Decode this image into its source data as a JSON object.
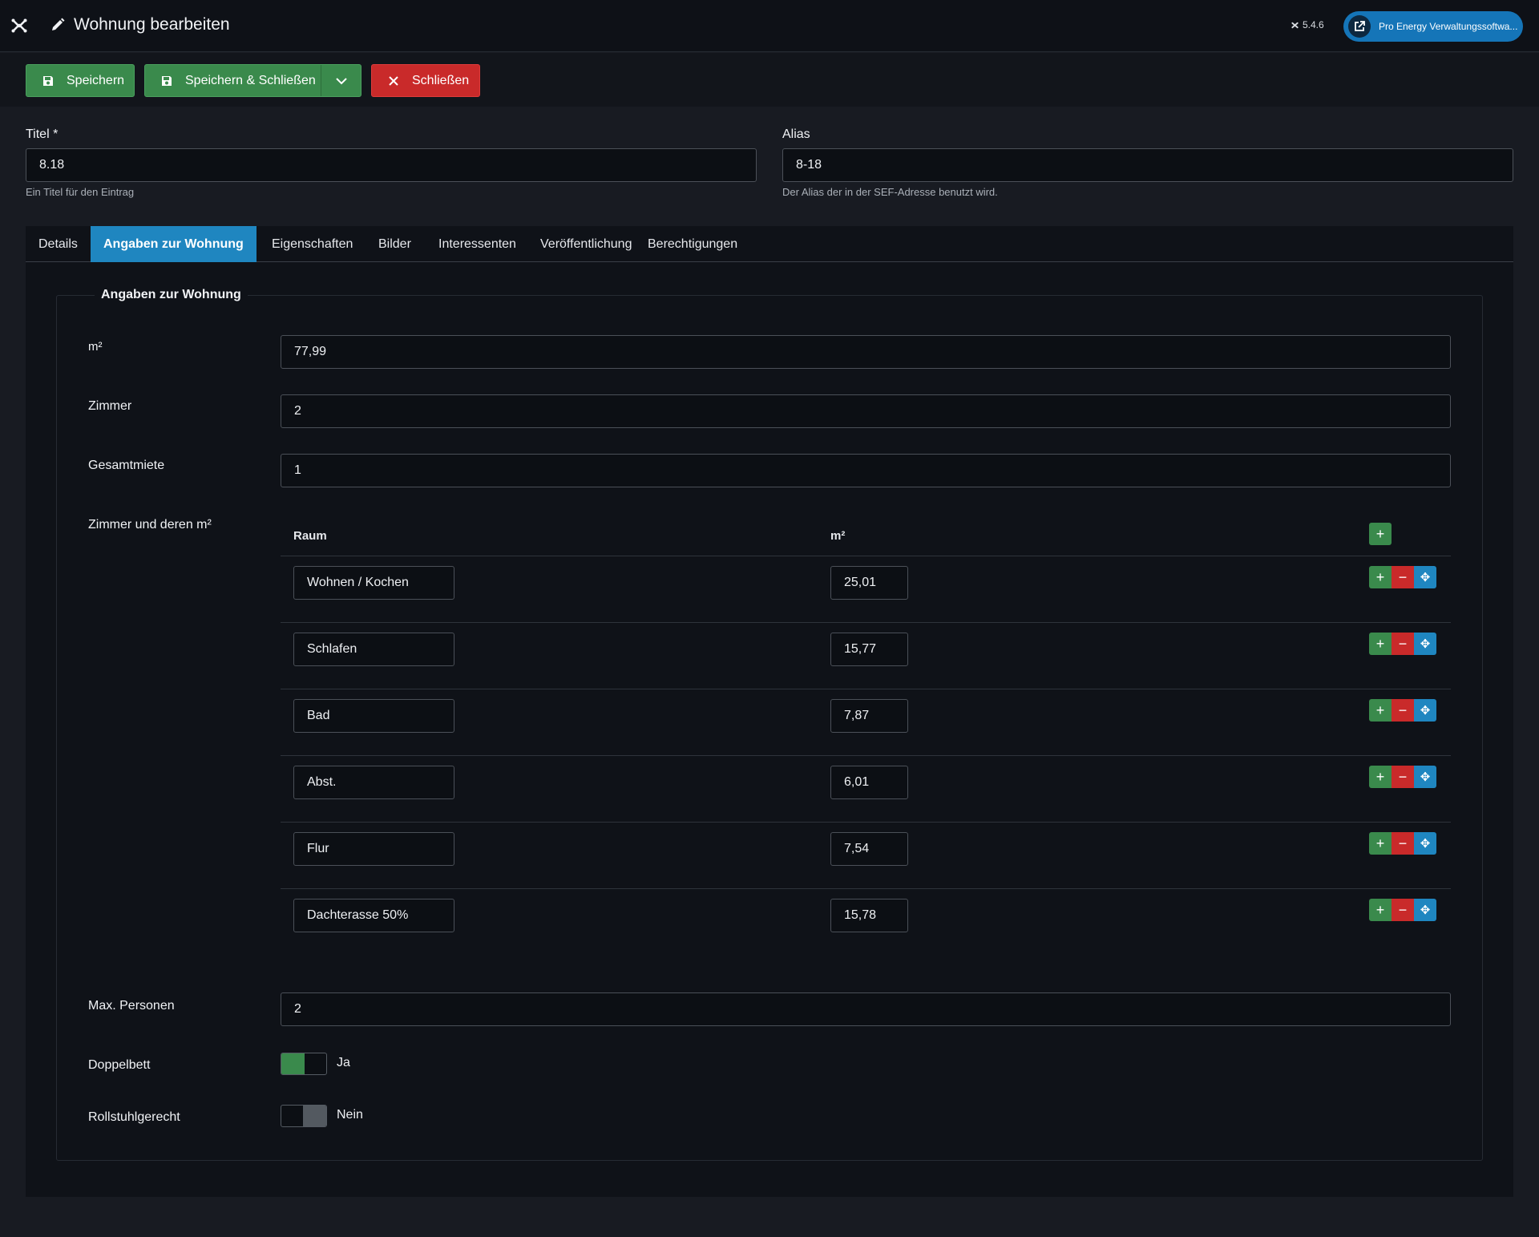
{
  "header": {
    "title": "Wohnung bearbeiten",
    "version": "5.4.6",
    "site_button": "Pro Energy Verwaltungssoftwa..."
  },
  "toolbar": {
    "save": "Speichern",
    "save_close": "Speichern & Schließen",
    "close": "Schließen"
  },
  "form": {
    "title_label": "Titel *",
    "title_value": "8.18",
    "title_hint": "Ein Titel für den Eintrag",
    "alias_label": "Alias",
    "alias_value": "8-18",
    "alias_hint": "Der Alias der in der SEF-Adresse benutzt wird."
  },
  "tabs": [
    "Details",
    "Angaben zur Wohnung",
    "Eigenschaften",
    "Bilder",
    "Interessenten",
    "Veröffentlichung",
    "Berechtigungen"
  ],
  "active_tab": "Angaben zur Wohnung",
  "fieldset": {
    "legend": "Angaben zur Wohnung",
    "sqm_label": "m²",
    "sqm_value": "77,99",
    "rooms_label": "Zimmer",
    "rooms_value": "2",
    "rent_label": "Gesamtmiete",
    "rent_value": "1",
    "rooms_table_label": "Zimmer und deren m²",
    "col_room": "Raum",
    "col_sqm": "m²",
    "rows": [
      {
        "room": "Wohnen / Kochen",
        "sqm": "25,01"
      },
      {
        "room": "Schlafen",
        "sqm": "15,77"
      },
      {
        "room": "Bad",
        "sqm": "7,87"
      },
      {
        "room": "Abst.",
        "sqm": "6,01"
      },
      {
        "room": "Flur",
        "sqm": "7,54"
      },
      {
        "room": "Dachterasse 50%",
        "sqm": "15,78"
      }
    ],
    "max_persons_label": "Max. Personen",
    "max_persons_value": "2",
    "double_bed_label": "Doppelbett",
    "double_bed_state": "Ja",
    "wheelchair_label": "Rollstuhlgerecht",
    "wheelchair_state": "Nein"
  },
  "colors": {
    "accent_blue": "#1f86c0",
    "green": "#3a8a4c",
    "red": "#c92a2a"
  }
}
